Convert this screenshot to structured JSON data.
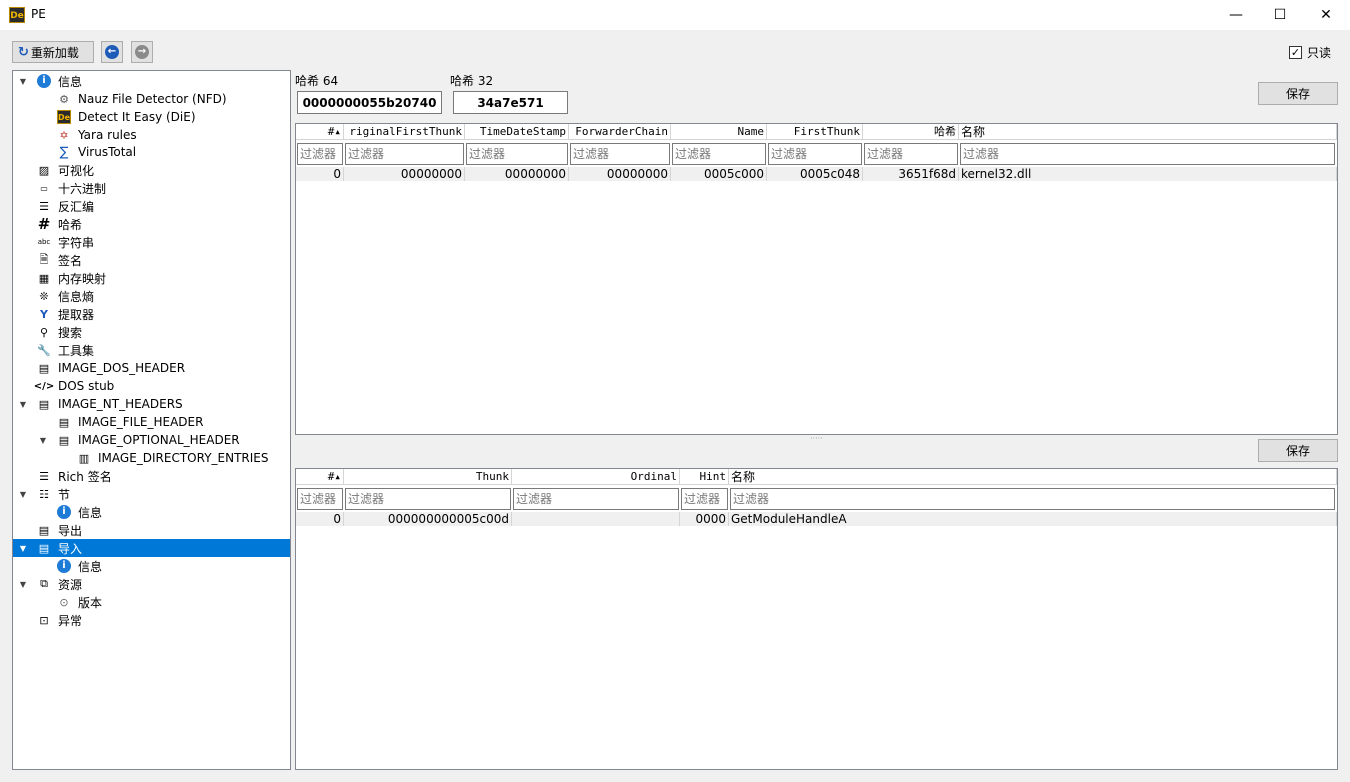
{
  "window": {
    "title": "PE",
    "minimize": "—",
    "maximize": "☐",
    "close": "✕",
    "app_icon_text": "De"
  },
  "toolbar": {
    "reload_label": "重新加载",
    "readonly_label": "只读",
    "readonly_checked": "✓"
  },
  "tree": {
    "items": [
      {
        "label": "信息",
        "icon": "info-icon"
      },
      {
        "label": "Nauz File Detector (NFD)",
        "icon": "nfd-icon"
      },
      {
        "label": "Detect It Easy (DiE)",
        "icon": "die-icon"
      },
      {
        "label": "Yara rules",
        "icon": "yara-icon"
      },
      {
        "label": "VirusTotal",
        "icon": "virustotal-icon"
      },
      {
        "label": "可视化",
        "icon": "image-icon"
      },
      {
        "label": "十六进制",
        "icon": "hex-icon"
      },
      {
        "label": "反汇编",
        "icon": "disasm-icon"
      },
      {
        "label": "哈希",
        "icon": "hash-icon"
      },
      {
        "label": "字符串",
        "icon": "strings-icon"
      },
      {
        "label": "签名",
        "icon": "signature-icon"
      },
      {
        "label": "内存映射",
        "icon": "memory-map-icon"
      },
      {
        "label": "信息熵",
        "icon": "entropy-icon"
      },
      {
        "label": "提取器",
        "icon": "extractor-icon"
      },
      {
        "label": "搜索",
        "icon": "search-icon"
      },
      {
        "label": "工具集",
        "icon": "wrench-icon"
      },
      {
        "label": "IMAGE_DOS_HEADER",
        "icon": "header-icon"
      },
      {
        "label": "DOS stub",
        "icon": "code-icon"
      },
      {
        "label": "IMAGE_NT_HEADERS",
        "icon": "header-icon"
      },
      {
        "label": "IMAGE_FILE_HEADER",
        "icon": "header-icon"
      },
      {
        "label": "IMAGE_OPTIONAL_HEADER",
        "icon": "header-icon"
      },
      {
        "label": "IMAGE_DIRECTORY_ENTRIES",
        "icon": "table-icon"
      },
      {
        "label": "Rich 签名",
        "icon": "list-icon"
      },
      {
        "label": "节",
        "icon": "sections-icon"
      },
      {
        "label": "信息",
        "icon": "info-icon"
      },
      {
        "label": "导出",
        "icon": "export-icon"
      },
      {
        "label": "导入",
        "icon": "import-icon"
      },
      {
        "label": "信息",
        "icon": "info-icon"
      },
      {
        "label": "资源",
        "icon": "resources-icon"
      },
      {
        "label": "版本",
        "icon": "version-icon"
      },
      {
        "label": "异常",
        "icon": "exception-icon"
      }
    ]
  },
  "hash": {
    "label64": "哈希 64",
    "value64": "0000000055b20740",
    "label32": "哈希 32",
    "value32": "34a7e571",
    "save_label": "保存"
  },
  "import_table": {
    "headers": [
      "#▴",
      "riginalFirstThunk",
      "TimeDateStamp",
      "ForwarderChain",
      "Name",
      "FirstThunk",
      "哈希",
      "名称"
    ],
    "filter_placeholder": "过滤器",
    "rows": [
      [
        "0",
        "00000000",
        "00000000",
        "00000000",
        "0005c000",
        "0005c048",
        "3651f68d",
        "kernel32.dll"
      ]
    ]
  },
  "functions_table": {
    "save_label": "保存",
    "headers": [
      "#▴",
      "Thunk",
      "Ordinal",
      "Hint",
      "名称"
    ],
    "filter_placeholder": "过滤器",
    "rows": [
      [
        "0",
        "000000000005c00d",
        "",
        "0000",
        "GetModuleHandleA"
      ]
    ]
  },
  "colors": {
    "selection": "#0078d7",
    "info_blue": "#1e7bd6",
    "nav_blue": "#1d5bb8"
  }
}
